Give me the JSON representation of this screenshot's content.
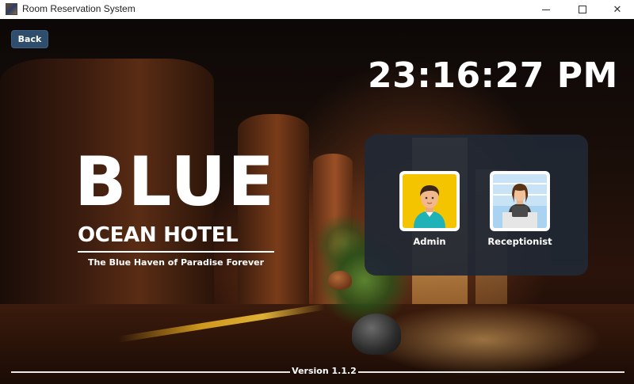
{
  "window": {
    "title": "Room Reservation System",
    "controls": {
      "minimize": "minimize",
      "maximize": "maximize",
      "close": "✕"
    }
  },
  "nav": {
    "back_label": "Back"
  },
  "clock": {
    "time": "23:16:27 PM"
  },
  "branding": {
    "title": "BLUE",
    "subtitle": "OCEAN HOTEL",
    "tagline": "The Blue Haven of Paradise Forever"
  },
  "roles": [
    {
      "label": "Admin",
      "icon": "admin-avatar-icon",
      "bg_color": "#f5c400"
    },
    {
      "label": "Receptionist",
      "icon": "receptionist-avatar-icon",
      "bg_color": "#a9d3f0"
    }
  ],
  "footer": {
    "version": "Version 1.1.2"
  },
  "colors": {
    "back_button": "#2f4e6d",
    "panel": "#202834"
  }
}
